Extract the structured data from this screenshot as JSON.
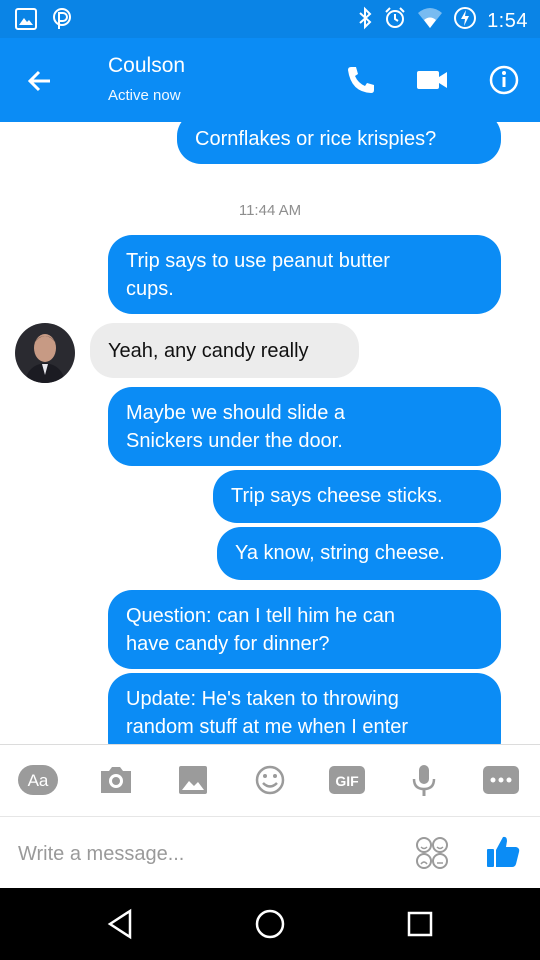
{
  "status_bar": {
    "time": "1:54",
    "left_icons": [
      "gallery-notification-icon",
      "parking-notification-icon"
    ],
    "right_icons": [
      "bluetooth-icon",
      "alarm-icon",
      "wifi-icon",
      "battery-charging-icon"
    ]
  },
  "header": {
    "contact_name": "Coulson",
    "contact_status": "Active now",
    "icons": [
      "back-arrow-icon",
      "phone-call-icon",
      "video-call-icon",
      "info-icon"
    ]
  },
  "messages": [
    {
      "from": "me",
      "text": "Cornflakes or rice krispies?"
    },
    {
      "type": "timestamp",
      "text": "11:44 AM"
    },
    {
      "from": "me",
      "lines": [
        "Trip says to use peanut butter",
        "cups."
      ]
    },
    {
      "from": "them",
      "text": "Yeah, any candy really"
    },
    {
      "from": "me",
      "lines": [
        "Maybe we should slide a",
        "Snickers under the door."
      ]
    },
    {
      "from": "me",
      "text": "Trip says cheese sticks."
    },
    {
      "from": "me",
      "text": "Ya know, string cheese."
    },
    {
      "from": "me",
      "lines": [
        "Question: can I tell him he can",
        "have candy for dinner?"
      ]
    },
    {
      "from": "me",
      "lines": [
        "Update: He's taken to throwing",
        "random stuff at me when I enter"
      ]
    }
  ],
  "composer": {
    "placeholder": "Write a message...",
    "toolbar_icons": [
      "text-format-icon",
      "camera-icon",
      "image-icon",
      "emoji-icon",
      "gif-icon",
      "microphone-icon",
      "more-icon"
    ],
    "toolbar_text": {
      "aa": "Aa",
      "gif": "GIF"
    },
    "right_icons": [
      "stickers-icon",
      "thumbs-up-icon"
    ]
  },
  "nav_bar": {
    "icons": [
      "back-nav-icon",
      "home-nav-icon",
      "recents-nav-icon"
    ]
  },
  "colors": {
    "brand_blue": "#0b8cf5",
    "status_blue": "#0a84e6",
    "incoming_bubble": "#ececec",
    "icon_gray": "#9b9b9b"
  }
}
